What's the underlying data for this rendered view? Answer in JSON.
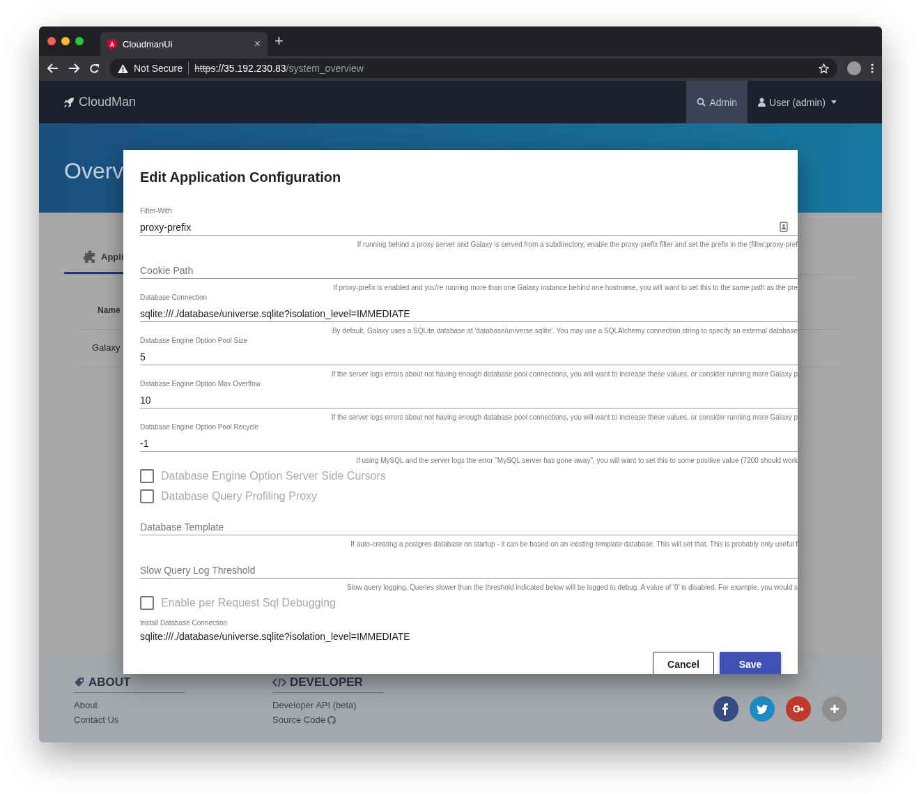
{
  "browser": {
    "tab": {
      "title": "CloudmanUi",
      "close": "×"
    },
    "new_tab": "+",
    "security": "Not Secure",
    "url": {
      "scheme": "https",
      "host": "://35.192.230.83",
      "path": "/system_overview"
    }
  },
  "navbar": {
    "brand": "CloudMan",
    "items": [
      {
        "label": "Admin",
        "selected": true
      },
      {
        "label": "User (admin)",
        "selected": false
      }
    ]
  },
  "hero": {
    "title": "Overv"
  },
  "page": {
    "tab": "Appli",
    "table": {
      "columns": [
        "Name"
      ],
      "rows": [
        "Galaxy"
      ]
    }
  },
  "dialog": {
    "title": "Edit Application Configuration",
    "fields": [
      {
        "kind": "text",
        "label": "Filter-With",
        "value": "proxy-prefix",
        "hint": "If running behind a proxy server and Galaxy is served from a subdirectory, enable the proxy-prefix filter and set the prefix in the [filter:proxy-pref"
      },
      {
        "kind": "text",
        "placeholder": "Cookie Path",
        "hint": "If proxy-prefix is enabled and you're running more than one Galaxy instance behind one hostname, you will want to set this to the same path as the pre"
      },
      {
        "kind": "text",
        "label": "Database Connection",
        "value": "sqlite:///./database/universe.sqlite?isolation_level=IMMEDIATE",
        "hint": "By default, Galaxy uses a SQLite database at 'database/universe.sqlite'. You may use a SQLAlchemy connection string to specify an external database"
      },
      {
        "kind": "text",
        "label": "Database Engine Option Pool Size",
        "value": "5",
        "hint": "If the server logs errors about not having enough database pool connections, you will want to increase these values, or consider running more Galaxy p"
      },
      {
        "kind": "text",
        "label": "Database Engine Option Max Overflow",
        "value": "10",
        "hint": "If the server logs errors about not having enough database pool connections, you will want to increase these values, or consider running more Galaxy p"
      },
      {
        "kind": "text",
        "label": "Database Engine Option Pool Recycle",
        "value": "-1",
        "hint": "If using MySQL and the server logs the error \"MySQL server has gone away\", you will want to set this to some positive value (7200 should work"
      },
      {
        "kind": "checkbox",
        "label": "Database Engine Option Server Side Cursors",
        "checked": false
      },
      {
        "kind": "checkbox",
        "label": "Database Query Profiling Proxy",
        "checked": false
      },
      {
        "kind": "text",
        "placeholder": "Database Template",
        "hint": "If auto-creating a postgres database on startup - it can be based on an existing template database. This will set that. This is probably only useful f"
      },
      {
        "kind": "text",
        "placeholder": "Slow Query Log Threshold",
        "hint": "Slow query logging. Queries slower than the threshold indicated below will be logged to debug. A value of '0' is disabled. For example, you would s"
      },
      {
        "kind": "checkbox",
        "label": "Enable per Request Sql Debugging",
        "checked": false
      },
      {
        "kind": "plain",
        "label": "Install Database Connection",
        "value": "sqlite:///./database/universe.sqlite?isolation_level=IMMEDIATE"
      }
    ],
    "buttons": [
      {
        "label": "Cancel",
        "kind": "secondary"
      },
      {
        "label": "Save",
        "kind": "primary"
      }
    ]
  },
  "footer": {
    "sections": [
      {
        "title": "ABOUT",
        "links": [
          "About",
          "Contact Us"
        ]
      },
      {
        "title": "DEVELOPER",
        "links": [
          "Developer API (beta)",
          "Source Code"
        ]
      }
    ],
    "social": [
      {
        "kind": "facebook",
        "color": "#344c80"
      },
      {
        "kind": "twitter",
        "color": "#1c8bc4"
      },
      {
        "kind": "google-plus",
        "color": "#c0392b"
      },
      {
        "kind": "more",
        "color": "#8e8e8e"
      }
    ]
  }
}
